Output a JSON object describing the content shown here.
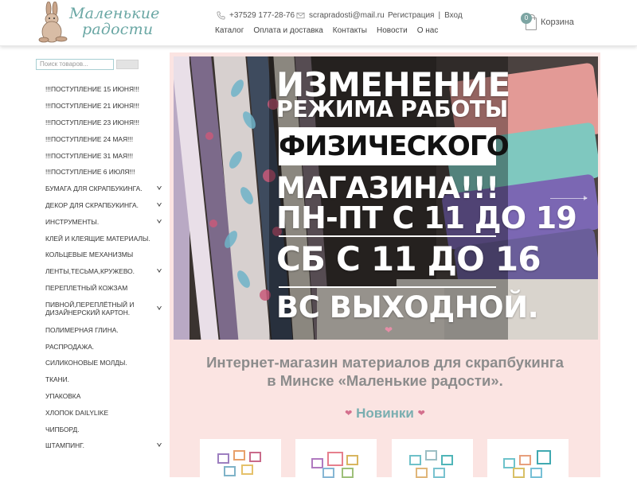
{
  "header": {
    "logo_text_line1": "Маленькие",
    "logo_text_line2": "радости",
    "phone": "+37529 177-28-76",
    "email": "scrapradosti@mail.ru",
    "register": "Регистрация",
    "login": "Вход",
    "separator": "|",
    "nav": [
      "Каталог",
      "Оплата и доставка",
      "Контакты",
      "Новости",
      "О нас"
    ],
    "cart_label": "Корзина",
    "cart_count": "0"
  },
  "sidebar": {
    "search_placeholder": "Поиск товаров...",
    "categories": [
      {
        "label": "!!!ПОСТУПЛЕНИЕ 15 ИЮНЯ!!!",
        "has_sub": false
      },
      {
        "label": "!!!ПОСТУПЛЕНИЕ 21 ИЮНЯ!!!",
        "has_sub": false
      },
      {
        "label": "!!!ПОСТУПЛЕНИЕ 23 ИЮНЯ!!!",
        "has_sub": false
      },
      {
        "label": "!!!ПОСТУПЛЕНИЕ 24 МАЯ!!!",
        "has_sub": false
      },
      {
        "label": "!!!ПОСТУПЛЕНИЕ 31 МАЯ!!!",
        "has_sub": false
      },
      {
        "label": "!!!ПОСТУПЛЕНИЕ 6 ИЮЛЯ!!!",
        "has_sub": false
      },
      {
        "label": "БУМАГА ДЛЯ СКРАПБУКИНГА.",
        "has_sub": true
      },
      {
        "label": "ДЕКОР ДЛЯ СКРАПБУКИНГА.",
        "has_sub": true
      },
      {
        "label": "ИНСТРУМЕНТЫ.",
        "has_sub": true
      },
      {
        "label": "КЛЕЙ И КЛЕЯЩИЕ МАТЕРИАЛЫ.",
        "has_sub": false
      },
      {
        "label": "КОЛЬЦЕВЫЕ МЕХАНИЗМЫ",
        "has_sub": false
      },
      {
        "label": "ЛЕНТЫ,ТЕСЬМА,КРУЖЕВО.",
        "has_sub": true
      },
      {
        "label": "ПЕРЕПЛЕТНЫЙ КОЖЗАМ",
        "has_sub": false
      },
      {
        "label": "ПИВНОЙ,ПЕРЕПЛЁТНЫЙ И ДИЗАЙНЕРСКИЙ КАРТОН.",
        "has_sub": true
      },
      {
        "label": "ПОЛИМЕРНАЯ ГЛИНА.",
        "has_sub": false
      },
      {
        "label": "РАСПРОДАЖА.",
        "has_sub": false
      },
      {
        "label": "СИЛИКОНОВЫЕ МОЛДЫ.",
        "has_sub": false
      },
      {
        "label": "ТКАНИ.",
        "has_sub": false
      },
      {
        "label": "УПАКОВКА",
        "has_sub": false
      },
      {
        "label": "ХЛОПОК DAILYLIKE",
        "has_sub": false
      },
      {
        "label": "ЧИПБОРД.",
        "has_sub": false
      },
      {
        "label": "ШТАМПИНГ.",
        "has_sub": true
      }
    ]
  },
  "banner": {
    "line1": "ИЗМЕНЕНИЕ",
    "line2": "РЕЖИМА РАБОТЫ",
    "line_box": "ФИЗИЧЕСКОГО",
    "line3": "МАГАЗИНА!!!",
    "line4": "ПН-ПТ С 11 ДО 19",
    "line5": "СБ С 11 ДО 16",
    "line6": "ВС ВЫХОДНОЙ."
  },
  "main": {
    "headline_line1": "Интернет-магазин материалов для скрапбукинга",
    "headline_line2": "в Минске «Маленькие радости».",
    "new_title": "Новинки",
    "heart": "❤"
  },
  "colors": {
    "accent": "#7aaeb0",
    "pink_bg": "#fbe4e2",
    "heart": "#d4708e"
  }
}
